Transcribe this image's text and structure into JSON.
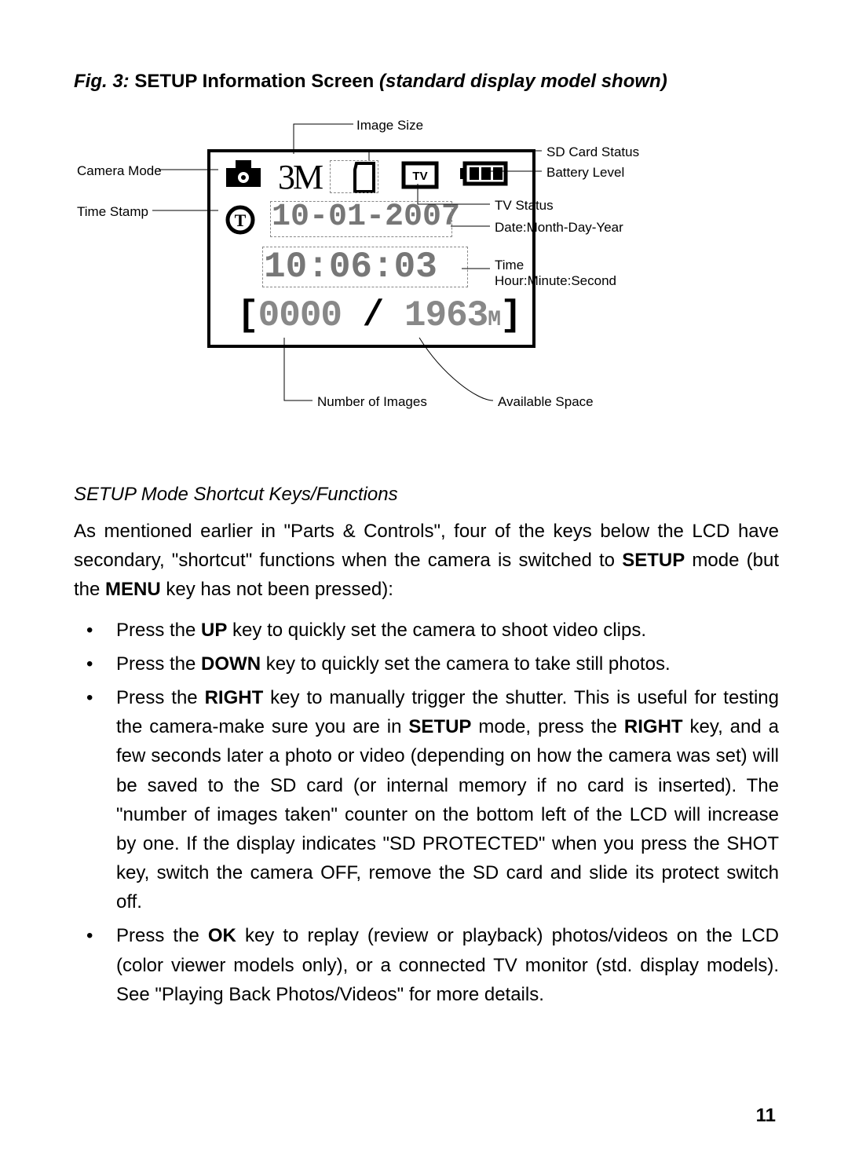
{
  "figure": {
    "prefix": "Fig. 3: ",
    "bold_title": "SETUP Information Screen",
    "italic_suffix": " (standard display model shown)"
  },
  "labels": {
    "image_size": "Image Size",
    "sd_card_status": "SD Card Status",
    "battery_level": "Battery Level",
    "camera_mode": "Camera Mode",
    "time_stamp": "Time Stamp",
    "tv_status": "TV Status",
    "date_line": "Date:Month-Day-Year",
    "time_line1": "Time",
    "time_line2": "Hour:Minute:Second",
    "num_images": "Number of Images",
    "avail_space": "Available Space"
  },
  "lcd": {
    "size": "3M",
    "date": "10-01-2007",
    "time": "10:06:03",
    "count_taken": "0000",
    "count_avail": "1963",
    "count_unit": "M"
  },
  "section_heading": "SETUP Mode Shortcut Keys/Functions",
  "intro": {
    "p1a": "As mentioned earlier in \"Parts & Controls\", four of the keys below the LCD have secondary, \"shortcut\" functions when the camera is switched to ",
    "p1b": "SETUP",
    "p1c": " mode (but the ",
    "p1d": "MENU",
    "p1e": " key has not been pressed):"
  },
  "bullets": {
    "b1a": "Press the ",
    "b1k": "UP",
    "b1b": " key to quickly set the camera to shoot video clips.",
    "b2a": "Press the ",
    "b2k": "DOWN",
    "b2b": " key to quickly set the camera to take still photos.",
    "b3a": "Press the ",
    "b3k": "RIGHT",
    "b3b": " key to manually trigger the shutter. This is useful for testing the camera-make sure you are in ",
    "b3c": "SETUP",
    "b3d": " mode, press the ",
    "b3e": "RIGHT",
    "b3f": " key, and a few seconds later a photo or video (depending on how the camera was set) will be saved to the SD card (or internal memory if no card is inserted). The \"number of images taken\" counter on the bottom left of the LCD will increase by one. If the display indicates \"SD PROTECTED\" when you press the SHOT key, switch the camera OFF, remove the SD card and slide its protect switch off.",
    "b4a": "Press the ",
    "b4k": "OK",
    "b4b": " key to replay (review or playback) photos/videos on the LCD (color viewer models only), or a connected TV monitor (std. display models). See \"Playing Back Photos/Videos\" for more details."
  },
  "page_number": "11"
}
